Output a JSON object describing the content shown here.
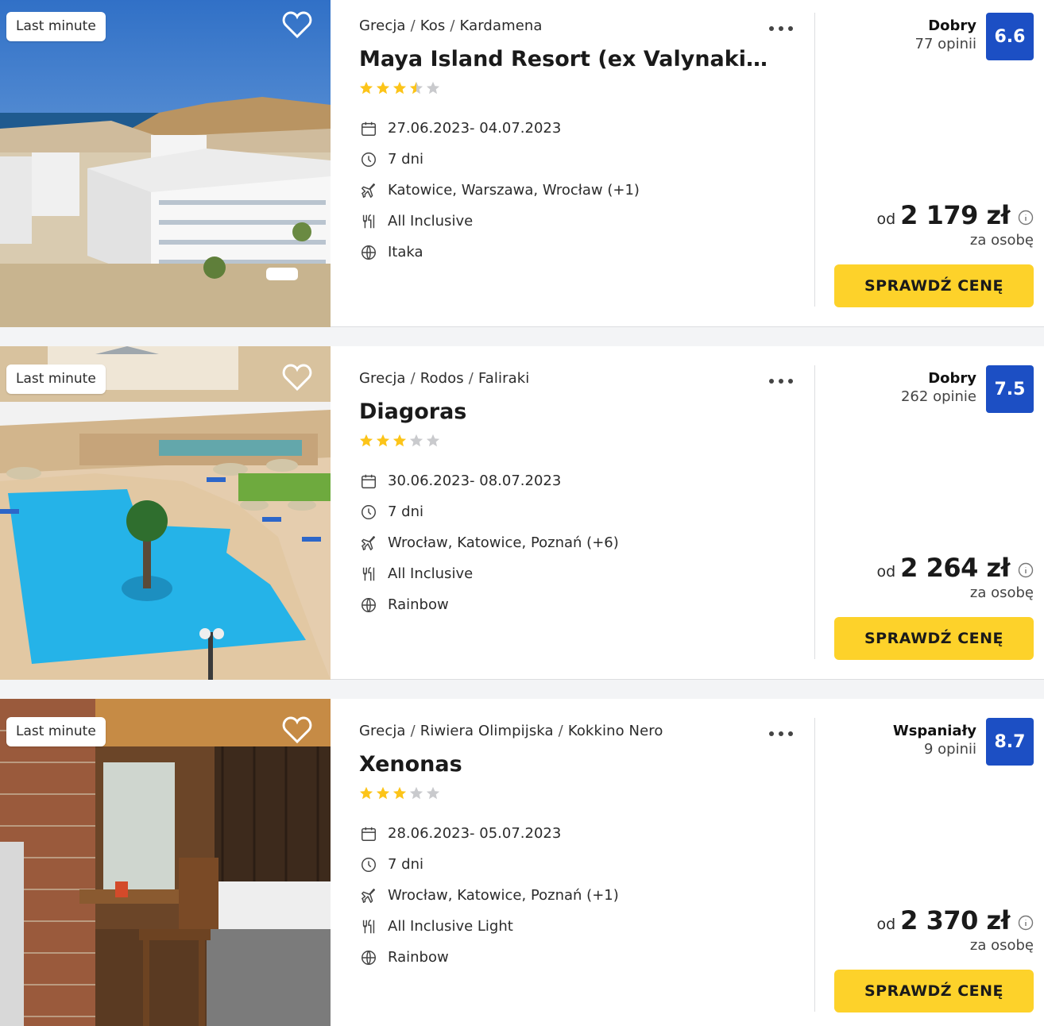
{
  "offers": [
    {
      "badge": "Last minute",
      "breadcrumb": [
        "Grecja",
        "Kos",
        "Kardamena"
      ],
      "name": "Maya Island Resort (ex Valynakis Be...",
      "stars": 3.5,
      "dates": "27.06.2023- 04.07.2023",
      "duration": "7 dni",
      "departures": "Katowice, Warszawa, Wrocław  (+1)",
      "board": "All Inclusive",
      "operator": "Itaka",
      "rating_label": "Dobry",
      "reviews": "77 opinii",
      "score": "6.6",
      "price_prefix": "od",
      "price": "2 179 zł",
      "price_note": "za osobę",
      "cta": "SPRAWDŹ CENĘ",
      "image": "seaside-hotel"
    },
    {
      "badge": "Last minute",
      "breadcrumb": [
        "Grecja",
        "Rodos",
        "Faliraki"
      ],
      "name": "Diagoras",
      "stars": 3,
      "dates": "30.06.2023- 08.07.2023",
      "duration": "7 dni",
      "departures": "Wrocław, Katowice, Poznań  (+6)",
      "board": "All Inclusive",
      "operator": "Rainbow",
      "rating_label": "Dobry",
      "reviews": "262 opinie",
      "score": "7.5",
      "price_prefix": "od",
      "price": "2 264 zł",
      "price_note": "za osobę",
      "cta": "SPRAWDŹ CENĘ",
      "image": "hotel-pool"
    },
    {
      "badge": "Last minute",
      "breadcrumb": [
        "Grecja",
        "Riwiera Olimpijska",
        "Kokkino Nero"
      ],
      "name": "Xenonas",
      "stars": 3,
      "dates": "28.06.2023- 05.07.2023",
      "duration": "7 dni",
      "departures": "Wrocław, Katowice, Poznań  (+1)",
      "board": "All Inclusive Light",
      "operator": "Rainbow",
      "rating_label": "Wspaniały",
      "reviews": "9 opinii",
      "score": "8.7",
      "price_prefix": "od",
      "price": "2 370 zł",
      "price_note": "za osobę",
      "cta": "SPRAWDŹ CENĘ",
      "image": "rustic-room"
    }
  ],
  "colors": {
    "accent": "#fdd22a",
    "score": "#1c4fc4",
    "star": "#fcc419",
    "star_empty": "#c9cacd"
  }
}
